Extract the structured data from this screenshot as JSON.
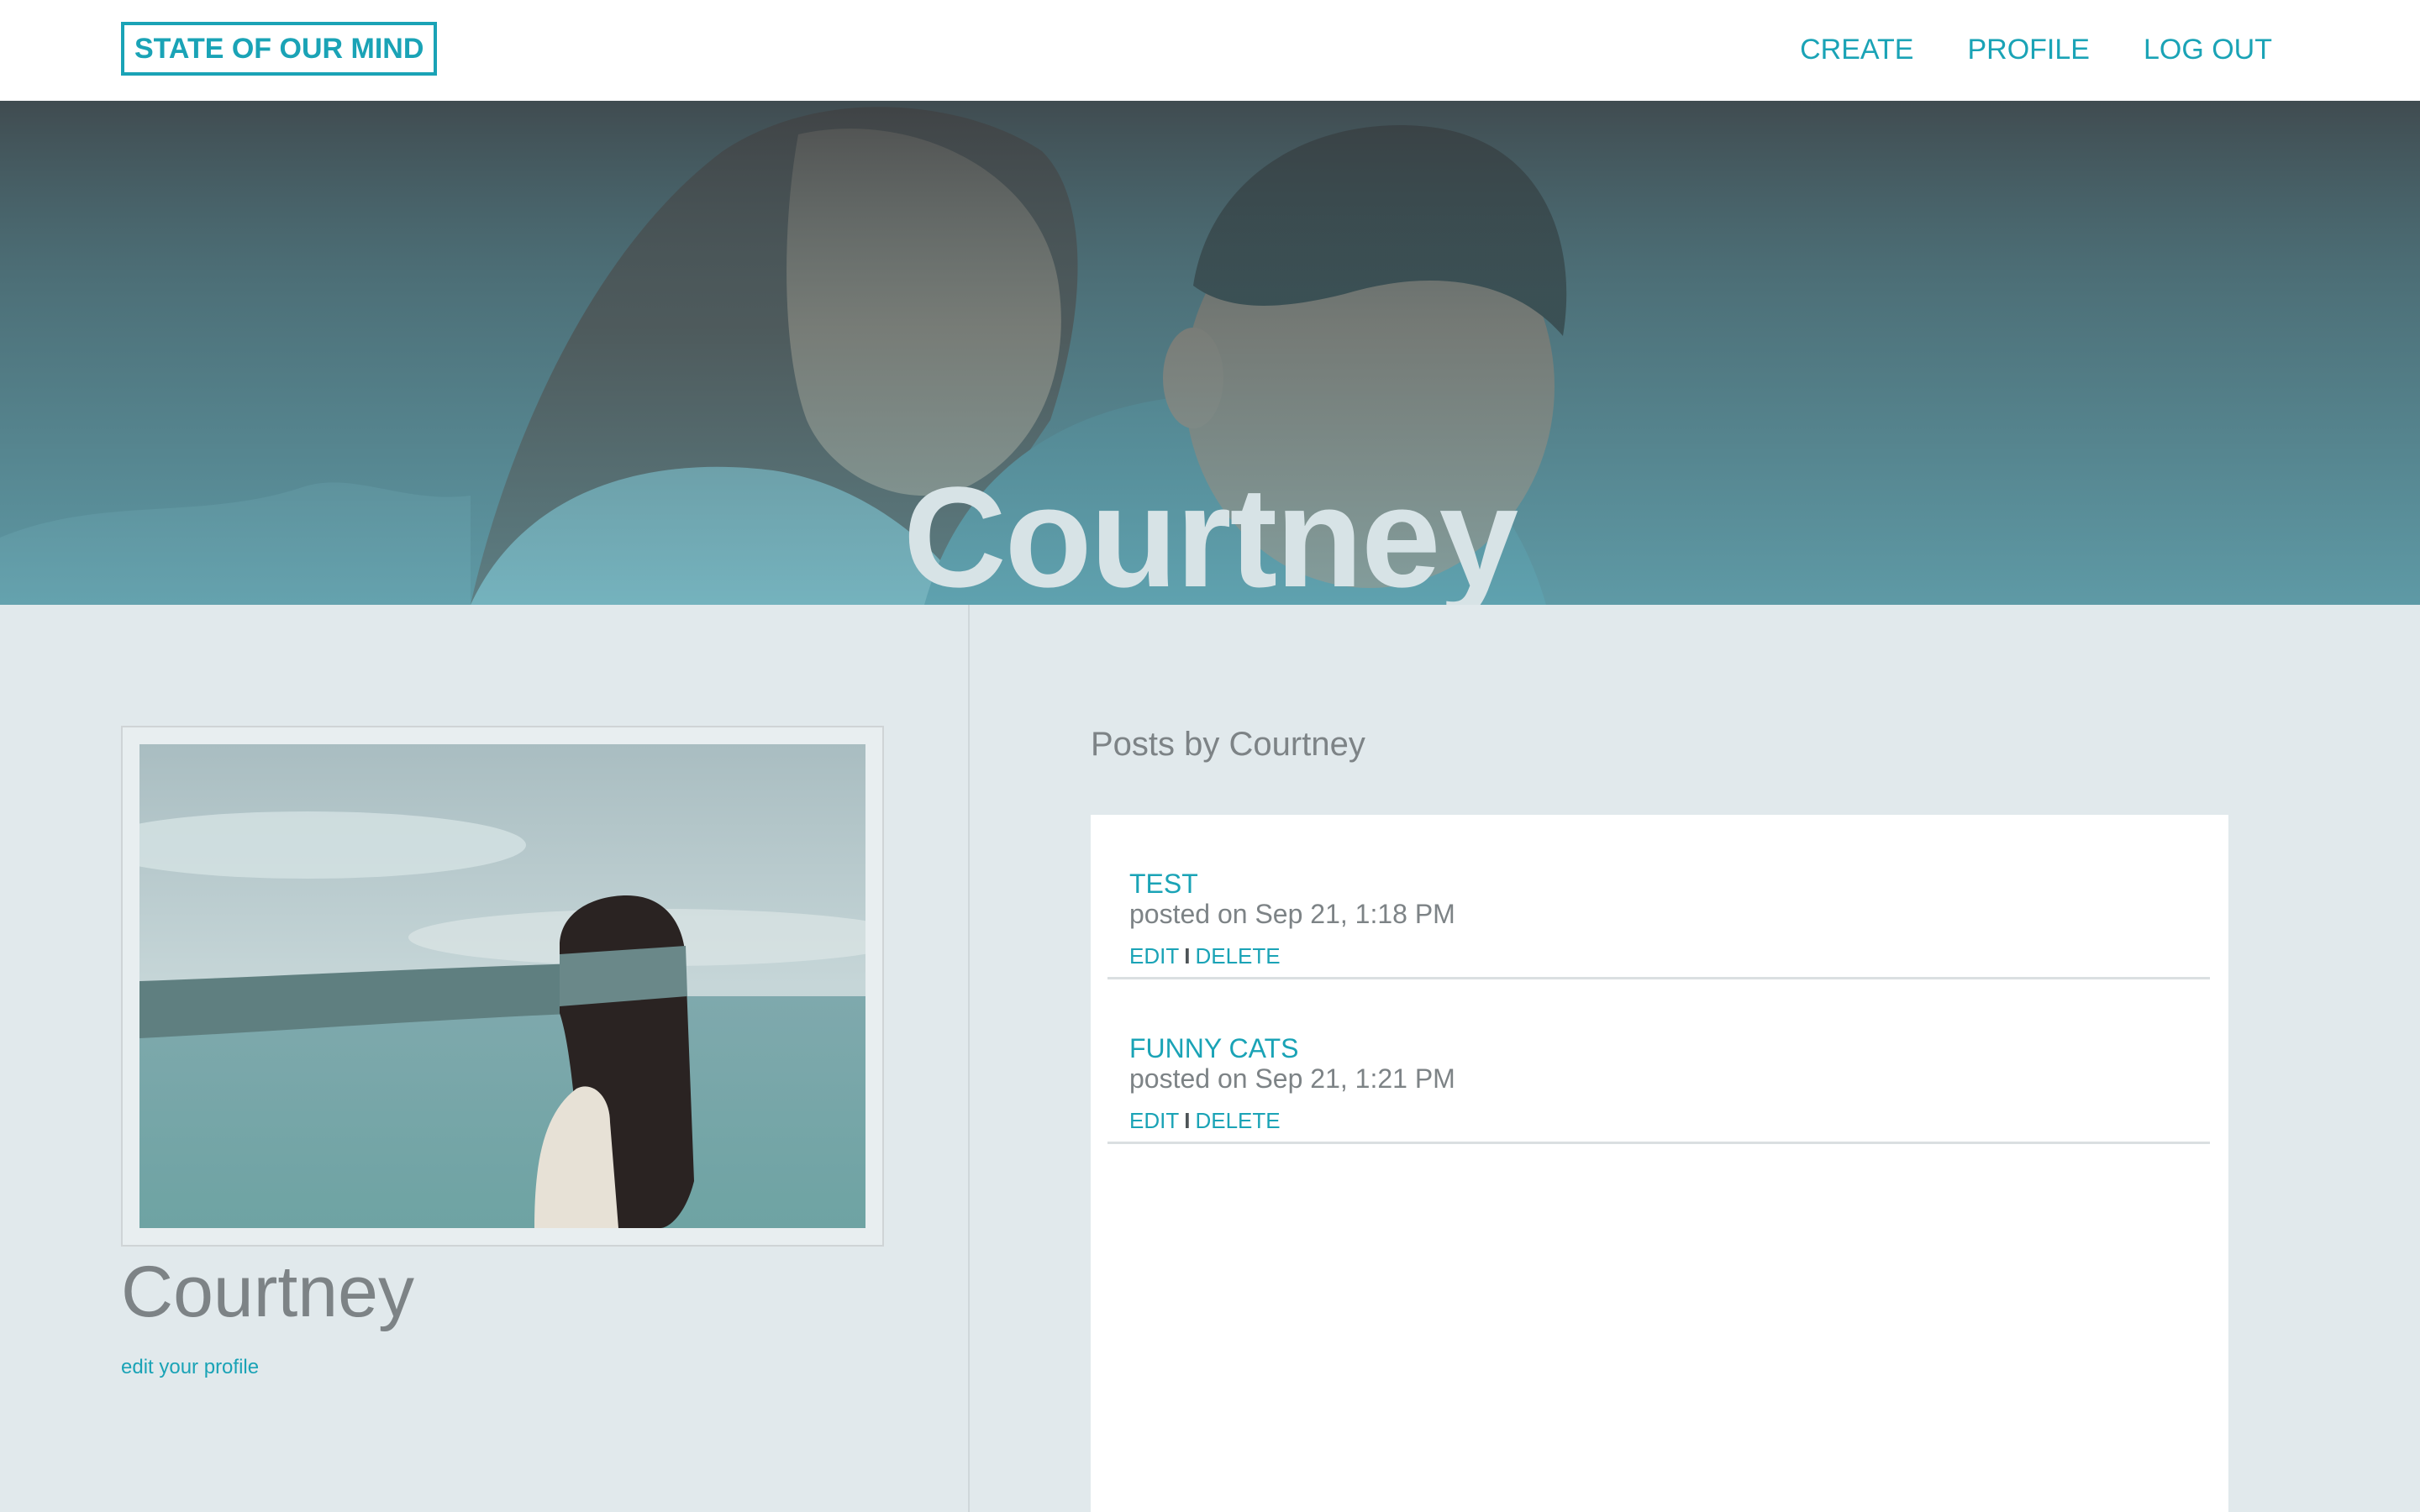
{
  "nav": {
    "brand": "STATE OF OUR MIND",
    "links": [
      "CREATE",
      "PROFILE",
      "LOG OUT"
    ]
  },
  "hero": {
    "title": "Courtney"
  },
  "profile": {
    "name": "Courtney",
    "edit_link": "edit your profile"
  },
  "posts_section": {
    "heading": "Posts by Courtney",
    "posts": [
      {
        "title": "TEST",
        "meta": "posted on Sep 21, 1:18 PM",
        "edit": "EDIT",
        "separator": "I",
        "delete": "DELETE"
      },
      {
        "title": "FUNNY CATS",
        "meta": "posted on Sep 21, 1:21 PM",
        "edit": "EDIT",
        "separator": "I",
        "delete": "DELETE"
      }
    ]
  },
  "colors": {
    "accent": "#1aa3b6",
    "muted_text": "#7d8386",
    "page_background": "#e1e9ec"
  }
}
